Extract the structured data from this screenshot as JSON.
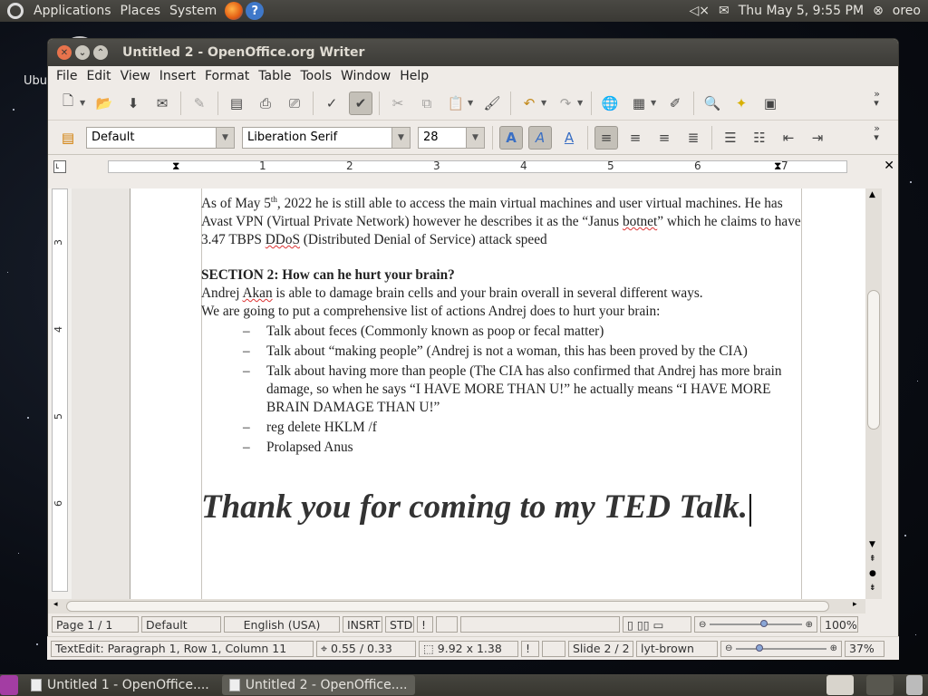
{
  "topbar": {
    "menus": [
      "Applications",
      "Places",
      "System"
    ],
    "datetime": "Thu May  5,  9:55 PM",
    "user": "oreo"
  },
  "desktop": {
    "icon_label": "Ubu"
  },
  "window": {
    "title": "Untitled 2 - OpenOffice.org Writer",
    "menu": [
      "File",
      "Edit",
      "View",
      "Insert",
      "Format",
      "Table",
      "Tools",
      "Window",
      "Help"
    ]
  },
  "formatting": {
    "style": "Default",
    "font": "Liberation Serif",
    "size": "28"
  },
  "ruler": {
    "numbers": [
      "1",
      "2",
      "3",
      "4",
      "5",
      "6",
      "7"
    ],
    "vnumbers": [
      "3",
      "4",
      "5",
      "6"
    ]
  },
  "document": {
    "p1_a": "As of May 5",
    "p1_sup": "th",
    "p1_b": ", 2022 he is still able to access the main virtual machines and user virtual machines. He has Avast VPN (Virtual Private Network) however he describes it as the “Janus ",
    "p1_w1": "botnet",
    "p1_c": "” which he claims to have 3.47 TBPS ",
    "p1_w2": "DDoS",
    "p1_d": " (Distributed Denial of Service) attack speed",
    "section": "SECTION 2: How can he hurt your brain?",
    "p2_a": "Andrej ",
    "p2_w": "Akan",
    "p2_b": " is able to damage brain cells and your brain overall in several different ways.",
    "p3": "We are going to put a comprehensive list of actions Andrej does to hurt your brain:",
    "bullet": "–",
    "list": [
      "Talk about feces (Commonly known as poop or fecal matter)",
      "Talk about “making people” (Andrej is not a woman, this has been proved by the CIA)",
      "Talk about having more than people (The CIA has also confirmed that Andrej has more brain damage, so when he says “I HAVE MORE THAN U!” he actually means “I HAVE MORE BRAIN DAMAGE THAN U!”",
      "reg delete HKLM /f",
      "Prolapsed Anus"
    ],
    "thanks": "Thank you for coming to my TED Talk."
  },
  "status": {
    "page": "Page 1 / 1",
    "style": "Default",
    "language": "English (USA)",
    "insert": "INSRT",
    "std": "STD",
    "zoom": "100%"
  },
  "status2": {
    "textedit": "TextEdit: Paragraph 1, Row 1, Column 11",
    "pos": "0.55 / 0.33",
    "size": "9.92 x 1.38",
    "slide": "Slide 2 / 2",
    "layout": "lyt-brown",
    "zoom": "37%"
  },
  "taskbar": {
    "items": [
      "Untitled 1 - OpenOffice....",
      "Untitled 2 - OpenOffice...."
    ]
  }
}
